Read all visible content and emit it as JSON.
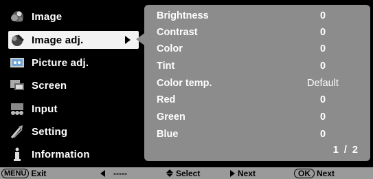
{
  "colors": {
    "panel": "#8c8c8c",
    "footer": "#9a9a9a",
    "selected": "#f2f2f2",
    "text": "#ffffff"
  },
  "sidebar": {
    "items": [
      {
        "label": "Image",
        "icon": "image-icon"
      },
      {
        "label": "Image adj.",
        "icon": "image-adj-icon",
        "selected": true
      },
      {
        "label": "Picture adj.",
        "icon": "picture-adj-icon"
      },
      {
        "label": "Screen",
        "icon": "screen-icon"
      },
      {
        "label": "Input",
        "icon": "input-icon"
      },
      {
        "label": "Setting",
        "icon": "setting-icon"
      },
      {
        "label": "Information",
        "icon": "information-icon"
      }
    ]
  },
  "panel": {
    "rows": [
      {
        "label": "Brightness",
        "value": "0"
      },
      {
        "label": "Contrast",
        "value": "0"
      },
      {
        "label": "Color",
        "value": "0"
      },
      {
        "label": "Tint",
        "value": "0"
      },
      {
        "label": "Color temp.",
        "value": "Default"
      },
      {
        "label": "Red",
        "value": "0"
      },
      {
        "label": "Green",
        "value": "0"
      },
      {
        "label": "Blue",
        "value": "0"
      }
    ],
    "pager": "1 / 2"
  },
  "footer": {
    "menu_key": "MENU",
    "exit_label": "Exit",
    "back_label": "-----",
    "select_label": "Select",
    "next_label": "Next",
    "ok_key": "OK",
    "ok_next_label": "Next"
  }
}
